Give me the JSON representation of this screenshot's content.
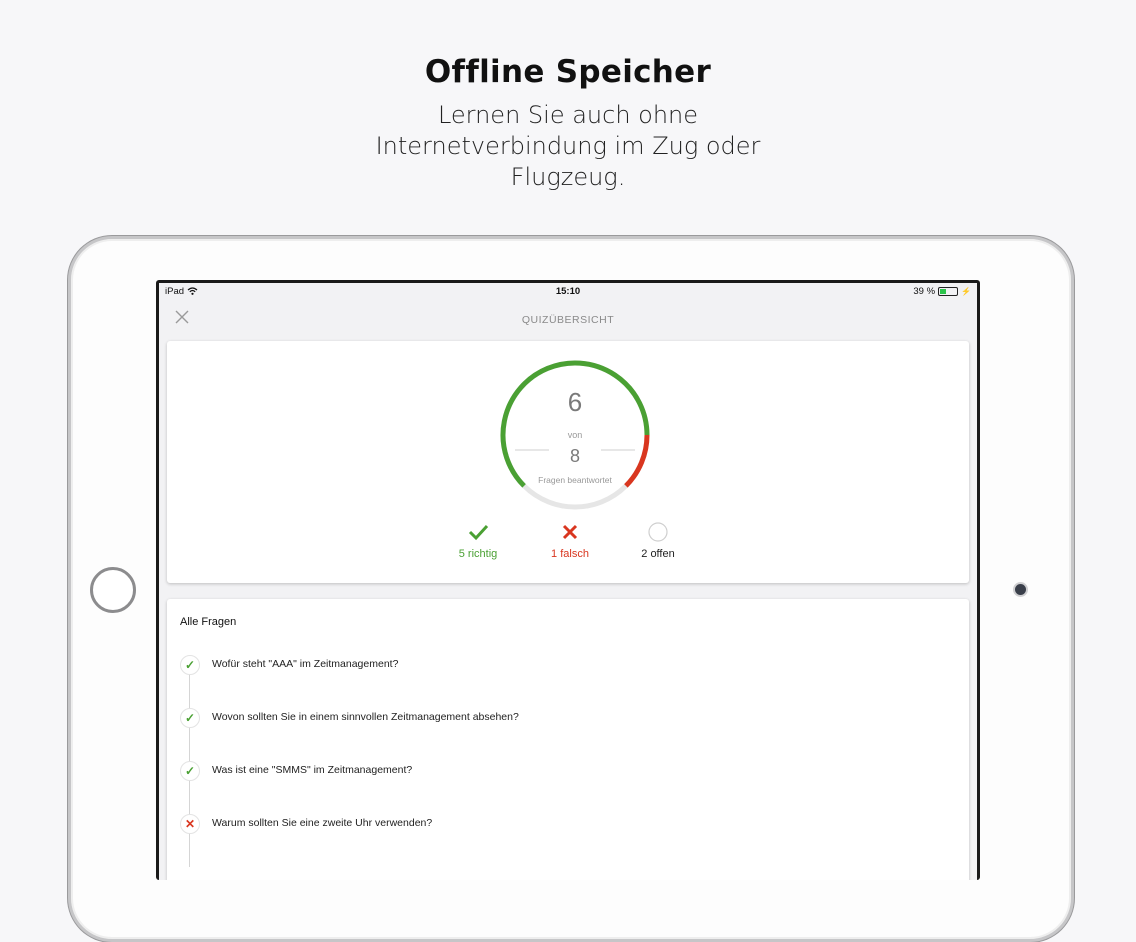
{
  "hero": {
    "title": "Offline Speicher",
    "subtitle": "Lernen Sie auch ohne Internetverbindung im Zug oder Flugzeug."
  },
  "statusbar": {
    "device": "iPad",
    "time": "15:10",
    "battery_text": "39 %",
    "battery_level": 0.39
  },
  "nav": {
    "title": "QUIZÜBERSICHT",
    "close_icon": "close-icon"
  },
  "summary": {
    "answered": "6",
    "von": "von",
    "total": "8",
    "caption": "Fragen beantwortet",
    "correct_count": 5,
    "wrong_count": 1,
    "open_count": 2,
    "stats": {
      "correct_label": "5 richtig",
      "wrong_label": "1 falsch",
      "open_label": "2 offen"
    },
    "colors": {
      "correct": "#4aa033",
      "wrong": "#d9361f",
      "open": "#dddddd"
    }
  },
  "questions": {
    "title": "Alle Fragen",
    "items": [
      {
        "status": "correct",
        "text": "Wofür steht \"AAA\" im Zeitmanagement?"
      },
      {
        "status": "correct",
        "text": "Wovon sollten Sie in einem sinnvollen Zeitmanagement absehen?"
      },
      {
        "status": "correct",
        "text": "Was ist eine \"SMMS\" im Zeitmanagement?"
      },
      {
        "status": "wrong",
        "text": "Warum sollten Sie eine zweite Uhr verwenden?"
      }
    ]
  }
}
